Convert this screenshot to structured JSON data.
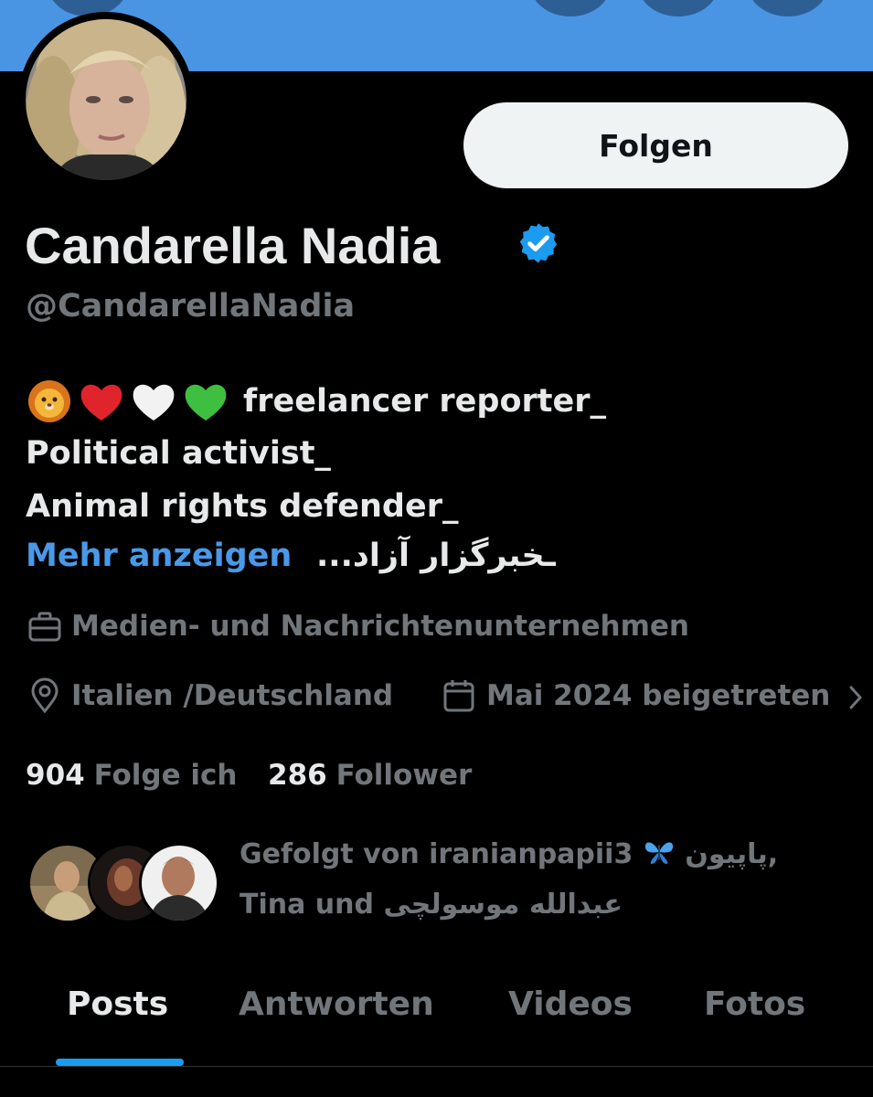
{
  "profile": {
    "name": "Candarella Nadia",
    "handle": "@CandarellaNadia",
    "follow_label": "Folgen",
    "verified": true
  },
  "bio": {
    "line1": "freelancer reporter_",
    "line2": "Political activist_",
    "line3": "Animal rights defender_",
    "rtl_text": "ـخبرگزار آزاد...",
    "more_label": "Mehr anzeigen",
    "emojis": [
      "lion-face",
      "red-heart",
      "white-heart",
      "green-heart"
    ]
  },
  "meta": {
    "category": "Medien- und Nachrichtenunternehmen",
    "location": "Italien /Deutschland",
    "joined": "Mai 2024 beigetreten"
  },
  "stats": {
    "following_count": "904",
    "following_label": "Folge ich",
    "followers_count": "286",
    "followers_label": "Follower"
  },
  "followed_by": {
    "prefix": "Gefolgt von iranianpapii3",
    "rtl_name1": "پاپیون",
    "comma": ",",
    "line2_prefix": "Tina und",
    "rtl_name2": "عبدالله موسولچی"
  },
  "tabs": [
    {
      "label": "Posts",
      "active": true
    },
    {
      "label": "Antworten",
      "active": false
    },
    {
      "label": "Videos",
      "active": false
    },
    {
      "label": "Fotos",
      "active": false
    }
  ],
  "colors": {
    "background": "#000000",
    "banner": "#4a95e3",
    "link": "#4a99e9",
    "muted": "#71767b",
    "verified": "#1d9bf0"
  }
}
